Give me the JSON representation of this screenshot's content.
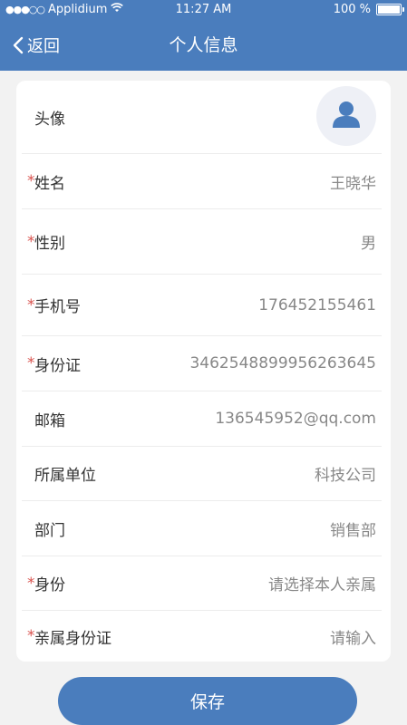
{
  "status_bar": {
    "signal": "●●●○○",
    "carrier": "Applidium",
    "time": "11:27 AM",
    "battery": "100 %"
  },
  "nav": {
    "back_label": "返回",
    "title": "个人信息"
  },
  "form": {
    "avatar_label": "头像",
    "required_mark": "*",
    "rows": [
      {
        "label": "姓名",
        "value": "王晓华"
      },
      {
        "label": "性别",
        "value": "男"
      },
      {
        "label": "手机号",
        "value": "176452155461"
      },
      {
        "label": "身份证",
        "value": "3462548899956263645"
      },
      {
        "label": "邮箱",
        "value": "136545952@qq.com"
      },
      {
        "label": "所属单位",
        "value": "科技公司"
      },
      {
        "label": "部门",
        "value": "销售部"
      },
      {
        "label": "身份",
        "value": "请选择本人亲属"
      },
      {
        "label": "亲属身份证",
        "value": "请输入"
      }
    ]
  },
  "save_label": "保存",
  "colors": {
    "primary": "#4a7dbd",
    "required": "#d9534f",
    "background": "#f2f2f2"
  }
}
